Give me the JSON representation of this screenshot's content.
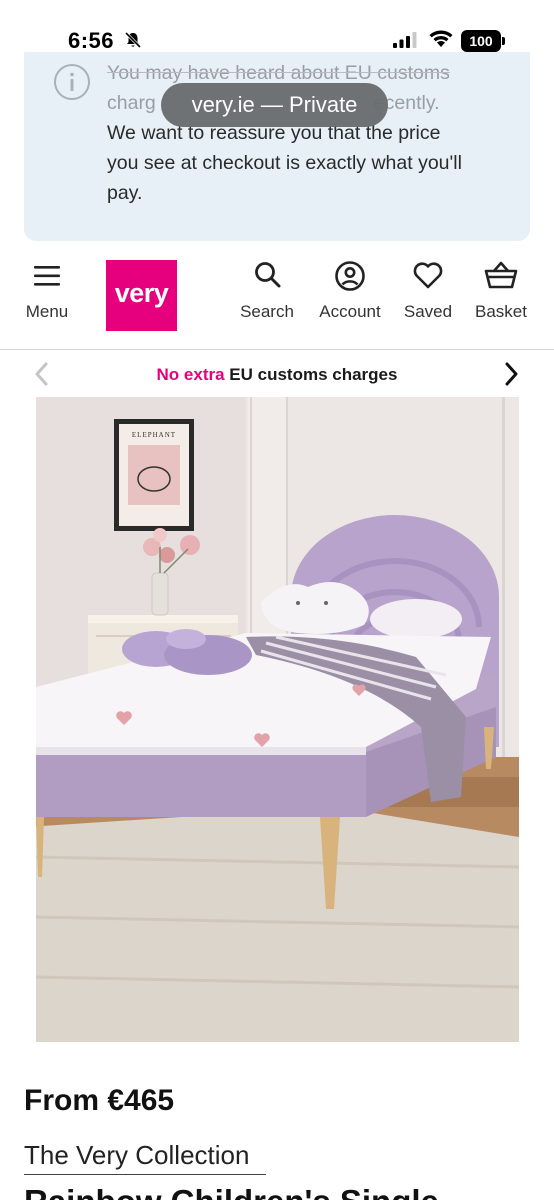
{
  "status_bar": {
    "time": "6:56",
    "battery": "100",
    "icons": [
      "bell-slash-icon",
      "signal-icon",
      "wifi-icon",
      "battery-icon"
    ]
  },
  "info_banner": {
    "line1": "You may have heard about EU customs",
    "line2_start": "charg",
    "line2_end": "ecently.",
    "line3": "We want to reassure you that the price",
    "line4": "you see at checkout is exactly what you'll",
    "line5": "pay."
  },
  "browser": {
    "url_pill": "very.ie — Private"
  },
  "header": {
    "menu_label": "Menu",
    "logo_text": "very",
    "search_label": "Search",
    "account_label": "Account",
    "saved_label": "Saved",
    "basket_label": "Basket",
    "brand_color": "#e6007e"
  },
  "promo": {
    "highlight": "No extra",
    "rest": " EU customs charges"
  },
  "product": {
    "price": "From €465",
    "brand": "The Very Collection",
    "title": "Rainbow Children's Single"
  }
}
